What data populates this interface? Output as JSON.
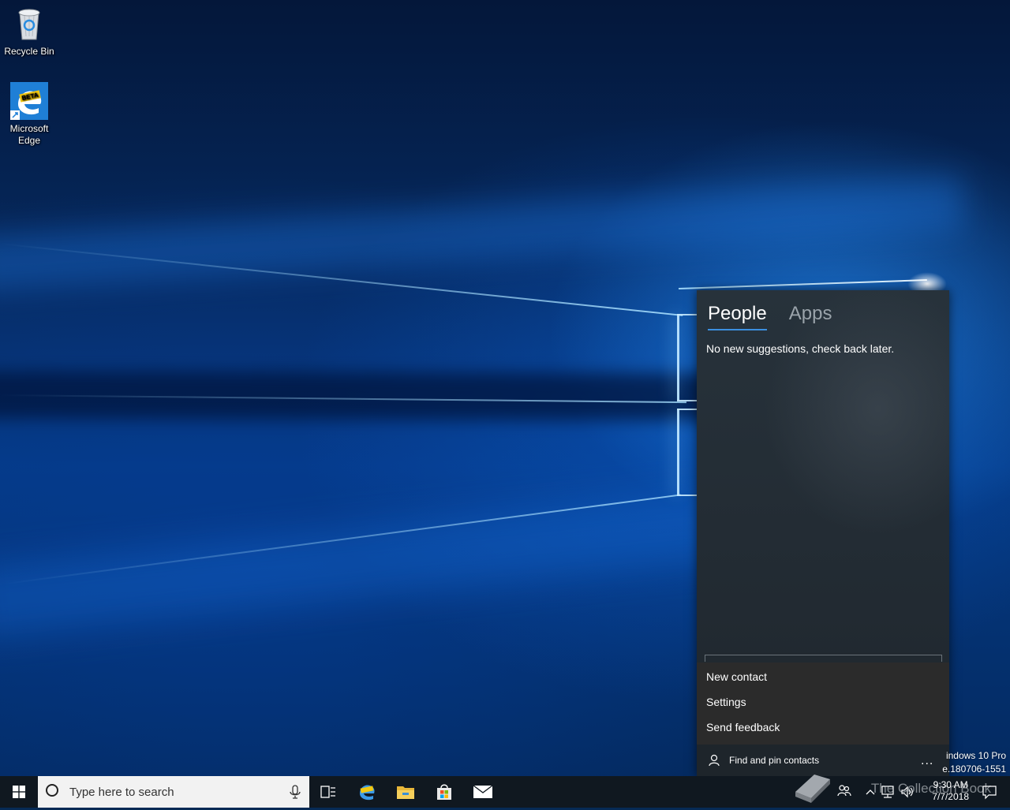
{
  "desktop": {
    "icons": [
      {
        "label": "Recycle Bin",
        "icon": "recycle-bin-icon"
      },
      {
        "label": "Microsoft Edge",
        "icon": "edge-beta-icon",
        "badge": "BETA"
      }
    ]
  },
  "people_flyout": {
    "tabs": [
      {
        "label": "People",
        "active": true
      },
      {
        "label": "Apps",
        "active": false
      }
    ],
    "message": "No new suggestions, check back later.",
    "menu": {
      "items": [
        "New contact",
        "Settings",
        "Send feedback"
      ]
    },
    "footer": {
      "find_label": "Find and pin contacts",
      "more_label": "..."
    }
  },
  "watermark": {
    "line1": "indows 10 Pro",
    "line2": "e.180706-1551"
  },
  "taskbar": {
    "search_placeholder": "Type here to search",
    "pinned": [
      "task-view-icon",
      "edge-beta-icon",
      "file-explorer-icon",
      "store-icon",
      "mail-icon"
    ],
    "tray": {
      "time": "9:30 AM",
      "date": "7/7/2018",
      "overlay_text": "The Collection Book"
    }
  },
  "colors": {
    "taskbar": "#101820",
    "flyout_bg": "#232c34",
    "menu_bg": "#2b2b2b",
    "accent": "#3b8fe0"
  }
}
